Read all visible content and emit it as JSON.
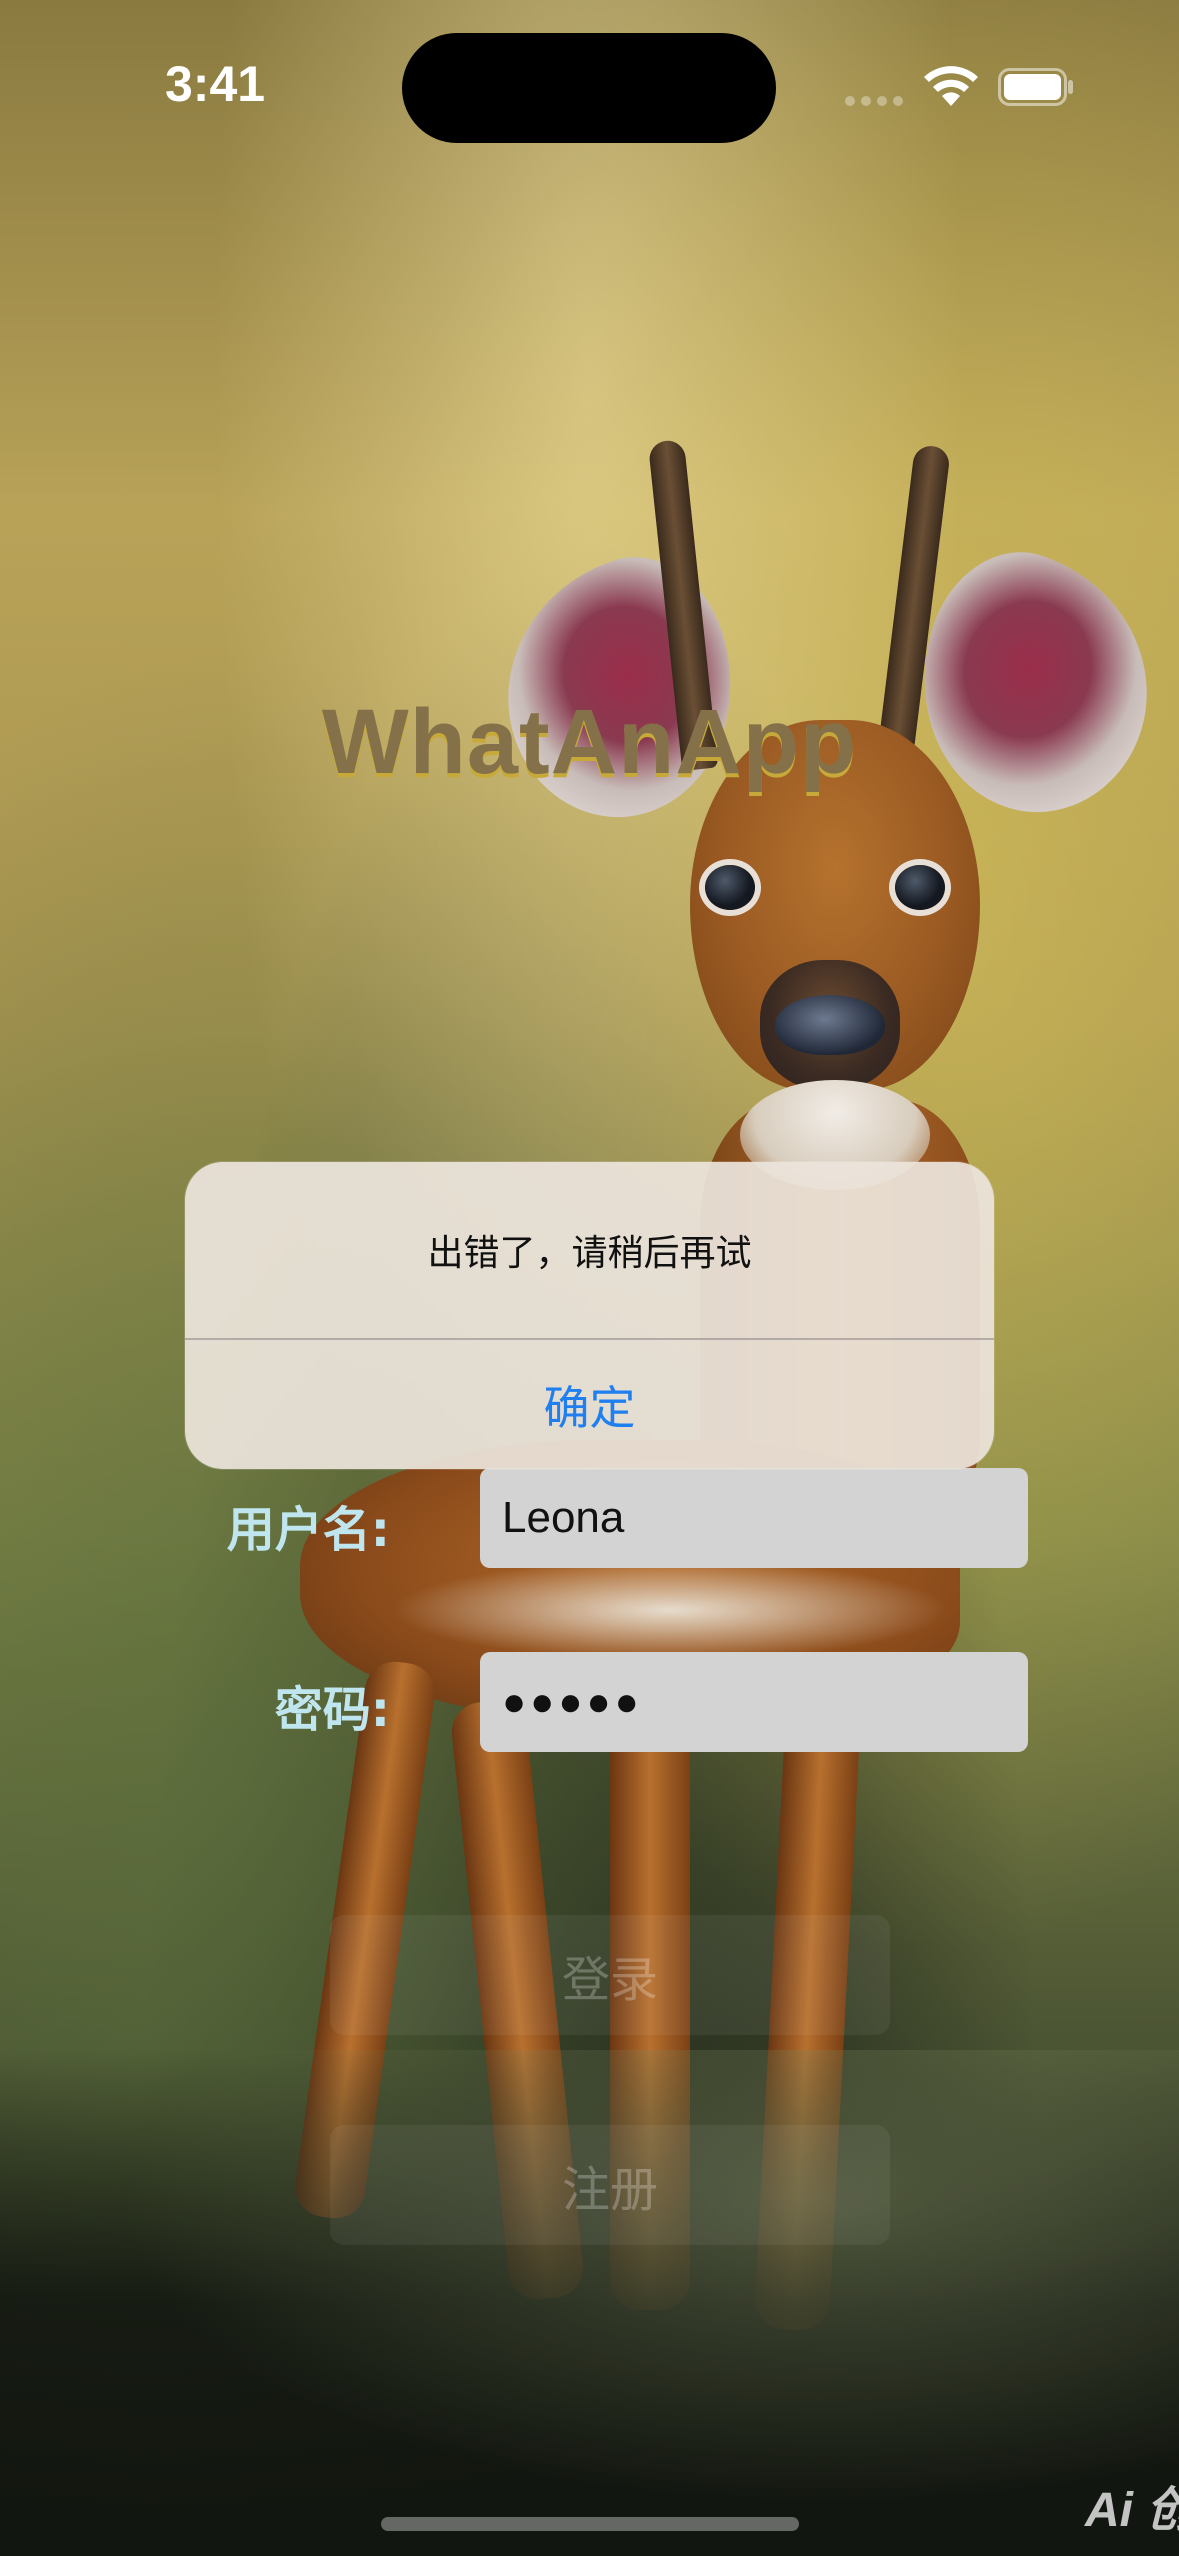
{
  "status_bar": {
    "time": "3:41"
  },
  "app": {
    "title": "WhatAnApp"
  },
  "form": {
    "username_label": "用户名:",
    "username_value": "Leona",
    "password_label": "密码:",
    "password_value": "●●●●●"
  },
  "buttons": {
    "login": "登录",
    "register": "注册"
  },
  "alert": {
    "message": "出错了，请稍后再试",
    "confirm": "确定"
  },
  "watermark": {
    "text": "Ai 创"
  },
  "colors": {
    "alert_button": "#1f7ff0",
    "label": "#bfe6ee",
    "title": "#84714a"
  }
}
